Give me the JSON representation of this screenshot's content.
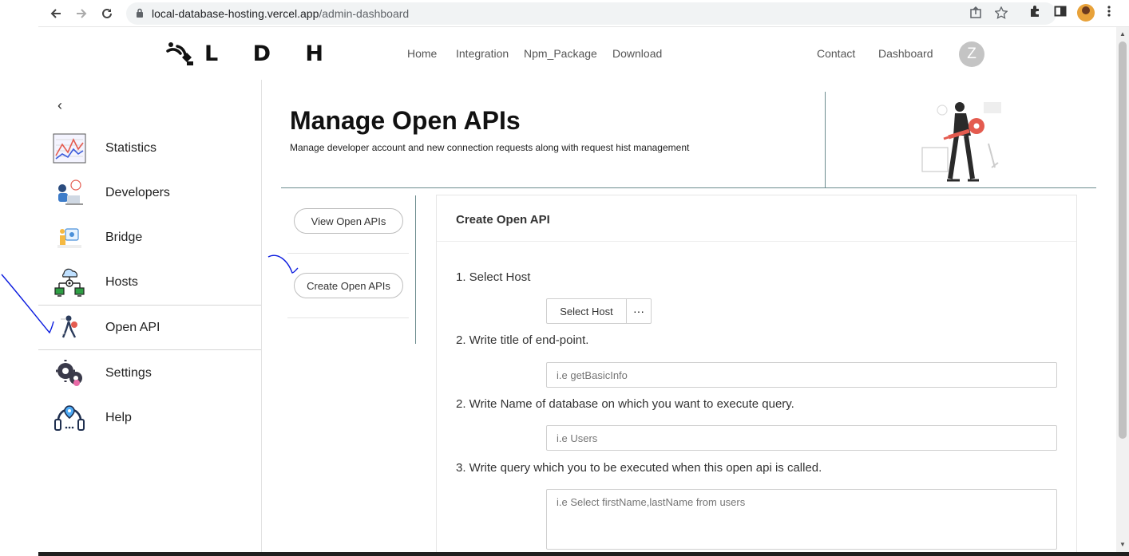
{
  "browser": {
    "url_host": "local-database-hosting.vercel.app",
    "url_path": "/admin-dashboard"
  },
  "header": {
    "brand": "L D H",
    "nav": [
      "Home",
      "Integration",
      "Npm_Package",
      "Download"
    ],
    "contact": "Contact",
    "dashboard": "Dashboard",
    "avatar_initial": "Z"
  },
  "sidebar": {
    "collapse_glyph": "‹",
    "items": [
      {
        "label": "Statistics",
        "icon": "statistics-icon"
      },
      {
        "label": "Developers",
        "icon": "developers-icon"
      },
      {
        "label": "Bridge",
        "icon": "bridge-icon"
      },
      {
        "label": "Hosts",
        "icon": "hosts-icon"
      },
      {
        "label": "Open API",
        "icon": "open-api-icon"
      },
      {
        "label": "Settings",
        "icon": "settings-icon"
      },
      {
        "label": "Help",
        "icon": "help-icon"
      }
    ],
    "active": "Open API"
  },
  "banner": {
    "title": "Manage Open APIs",
    "subtitle": "Manage developer account and new connection requests along with request hist management"
  },
  "subnav": {
    "view": "View Open APIs",
    "create": "Create Open APIs"
  },
  "card": {
    "title": "Create Open API",
    "step1": "1. Select Host",
    "select_host": "Select Host",
    "more": "···",
    "step2a": "2. Write title of end-point.",
    "title_placeholder": "i.e getBasicInfo",
    "step2b": "2. Write Name of database on which you want to execute query.",
    "db_placeholder": "i.e Users",
    "step3": "3. Write query which you to be executed when this open api is called.",
    "query_placeholder": "i.e Select firstName,lastName from users"
  },
  "colors": {
    "divider": "#6c8c8e",
    "accent_red": "#e45b4f",
    "ink_annotation": "#0a1adf"
  }
}
